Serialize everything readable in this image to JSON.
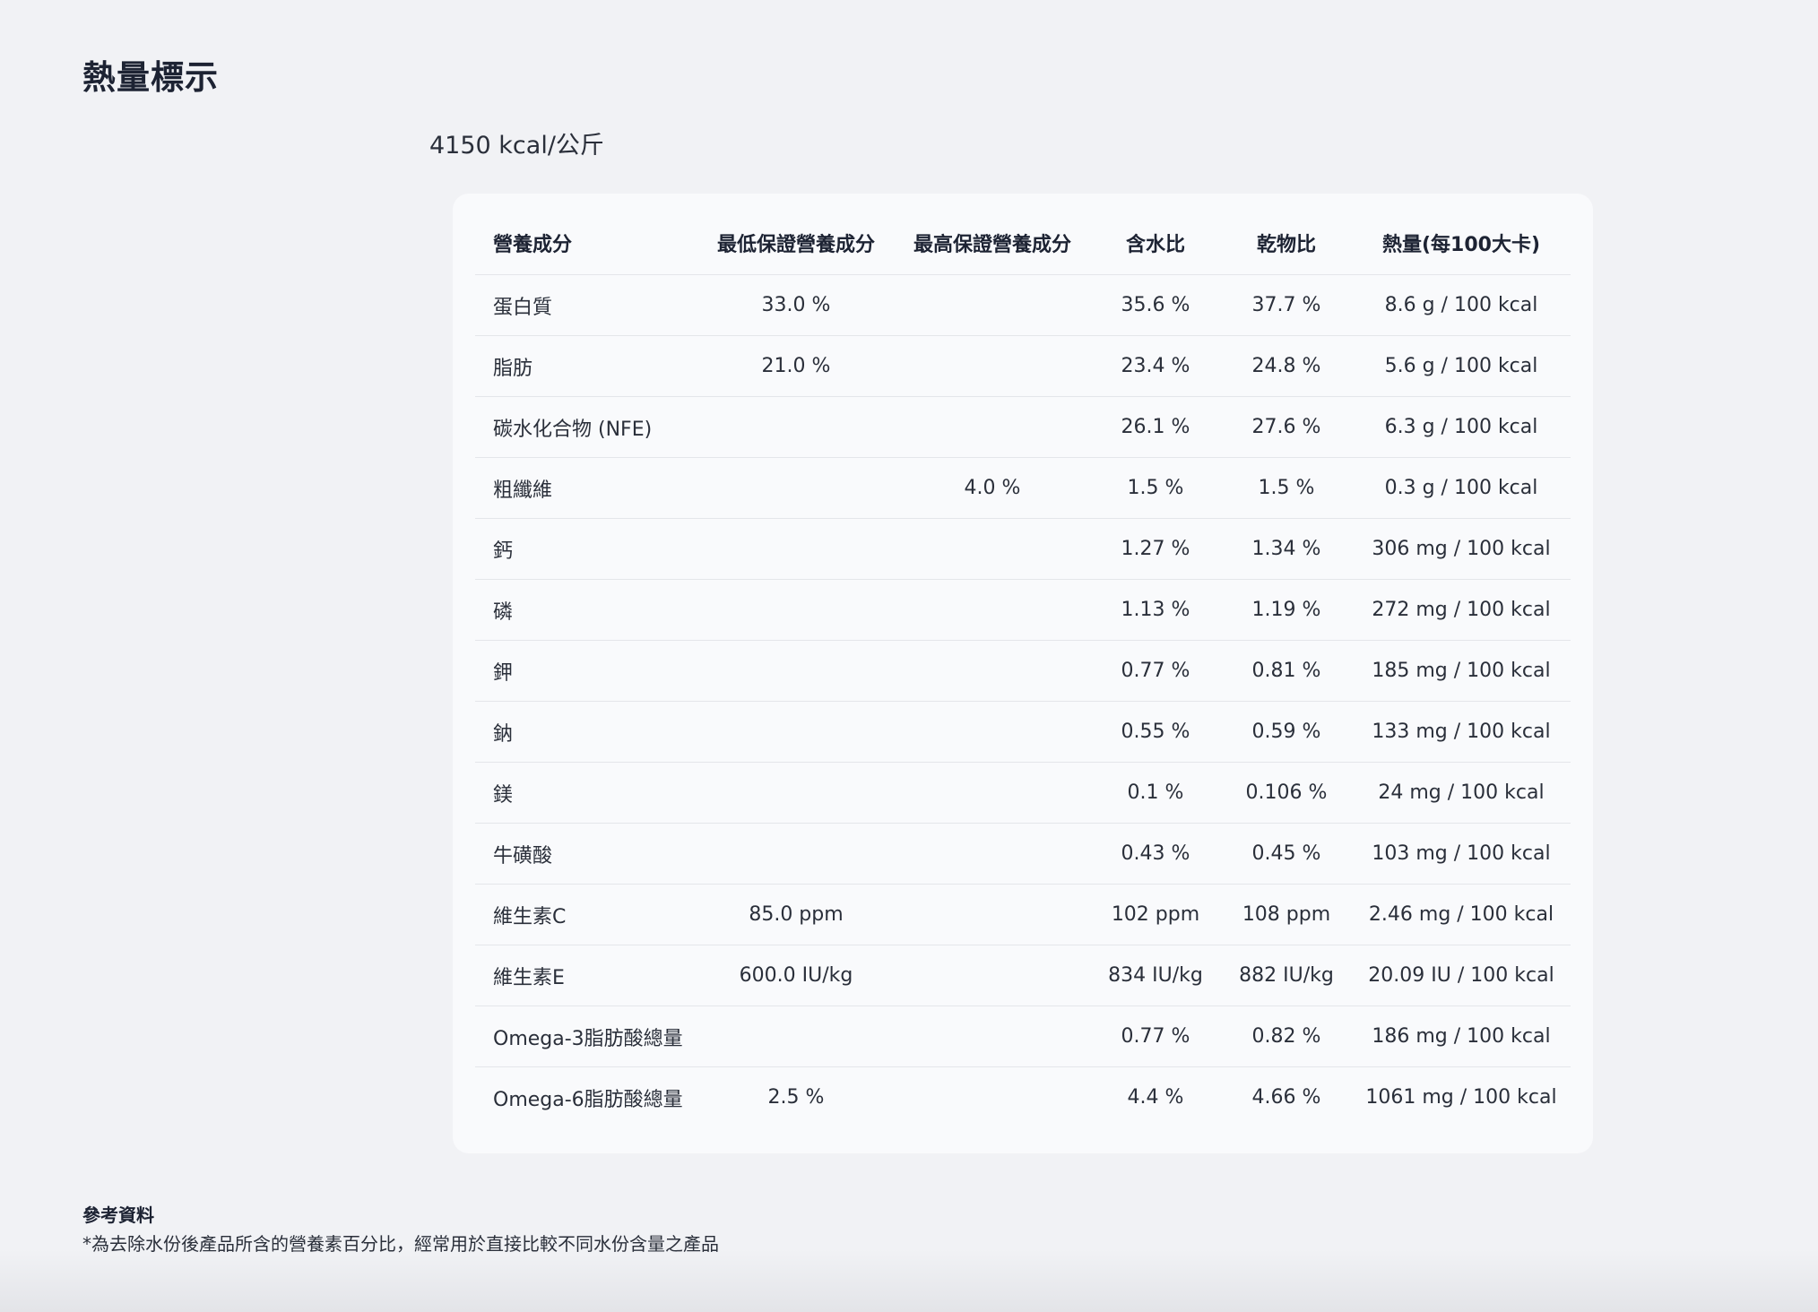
{
  "section": {
    "title": "熱量標示",
    "calorie": "4150 kcal/公斤"
  },
  "table": {
    "headers": [
      "營養成分",
      "最低保證營養成分",
      "最高保證營養成分",
      "含水比",
      "乾物比",
      "熱量(每100大卡)"
    ],
    "rows": [
      [
        "蛋白質",
        "33.0 %",
        "",
        "35.6 %",
        "37.7 %",
        "8.6 g / 100 kcal"
      ],
      [
        "脂肪",
        "21.0 %",
        "",
        "23.4 %",
        "24.8 %",
        "5.6 g / 100 kcal"
      ],
      [
        "碳水化合物 (NFE)",
        "",
        "",
        "26.1 %",
        "27.6 %",
        "6.3 g / 100 kcal"
      ],
      [
        "粗纖維",
        "",
        "4.0 %",
        "1.5 %",
        "1.5 %",
        "0.3 g / 100 kcal"
      ],
      [
        "鈣",
        "",
        "",
        "1.27 %",
        "1.34 %",
        "306 mg / 100 kcal"
      ],
      [
        "磷",
        "",
        "",
        "1.13 %",
        "1.19 %",
        "272 mg / 100 kcal"
      ],
      [
        "鉀",
        "",
        "",
        "0.77 %",
        "0.81 %",
        "185 mg / 100 kcal"
      ],
      [
        "鈉",
        "",
        "",
        "0.55 %",
        "0.59 %",
        "133 mg / 100 kcal"
      ],
      [
        "鎂",
        "",
        "",
        "0.1 %",
        "0.106 %",
        "24 mg / 100 kcal"
      ],
      [
        "牛磺酸",
        "",
        "",
        "0.43 %",
        "0.45 %",
        "103 mg / 100 kcal"
      ],
      [
        "維生素C",
        "85.0 ppm",
        "",
        "102 ppm",
        "108 ppm",
        "2.46 mg / 100 kcal"
      ],
      [
        "維生素E",
        "600.0 IU/kg",
        "",
        "834 IU/kg",
        "882 IU/kg",
        "20.09 IU / 100 kcal"
      ],
      [
        "Omega-3脂肪酸總量",
        "",
        "",
        "0.77 %",
        "0.82 %",
        "186 mg / 100 kcal"
      ],
      [
        "Omega-6脂肪酸總量",
        "2.5 %",
        "",
        "4.4 %",
        "4.66 %",
        "1061 mg / 100 kcal"
      ]
    ]
  },
  "reference": {
    "title": "參考資料",
    "note": "*為去除水份後產品所含的營養素百分比，經常用於直接比較不同水份含量之產品"
  }
}
